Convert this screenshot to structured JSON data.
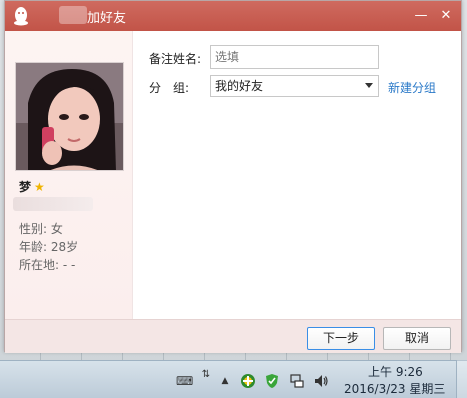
{
  "window": {
    "title": "加好友",
    "minimize_label": "—",
    "close_label": "✕"
  },
  "profile": {
    "nickname": "梦",
    "star": "★",
    "gender": "性别: 女",
    "age": "年龄: 28岁",
    "location": "所在地: -   -"
  },
  "form": {
    "remark_label": "备注姓名:",
    "remark_placeholder": "选填",
    "group_label": "分　组:",
    "group_value": "我的好友",
    "new_group_link": "新建分组"
  },
  "footer": {
    "next_label": "下一步",
    "cancel_label": "取消"
  },
  "taskbar": {
    "time": "上午 9:26",
    "date": "2016/3/23 星期三"
  },
  "colors": {
    "titlebar": "#c9584c",
    "link": "#2a79c8"
  },
  "icons": [
    "qq-penguin-icon",
    "keyboard-icon",
    "network-arrows-icon",
    "chevron-up-icon",
    "plus-shield-icon",
    "security-shield-icon",
    "network-icon",
    "volume-icon"
  ]
}
